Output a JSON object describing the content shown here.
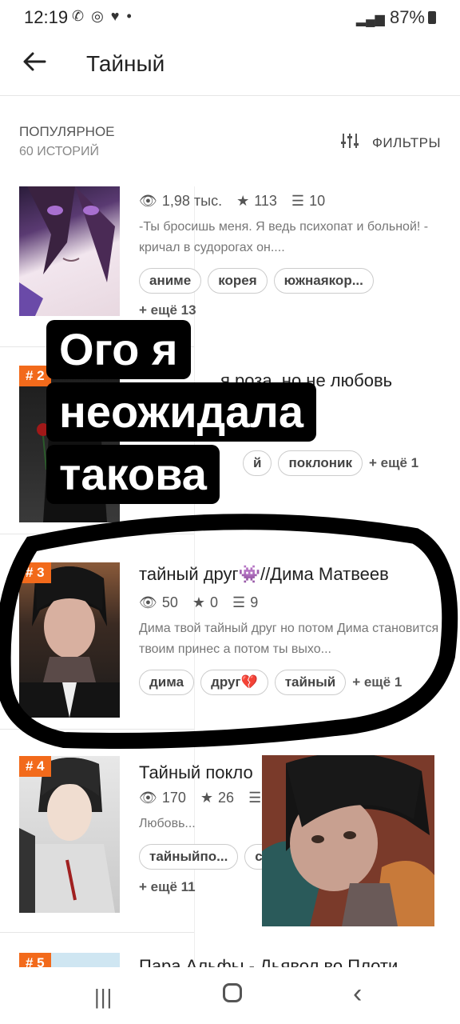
{
  "status_bar": {
    "time": "12:19",
    "icons": "✆ ◎ ♥ •",
    "network": "📶",
    "battery": "87%"
  },
  "app_bar": {
    "title": "Тайный"
  },
  "sort": {
    "title": "ПОПУЛЯРНОЕ",
    "count": "60 ИСТОРИЙ",
    "filters_label": "ФИЛЬТРЫ"
  },
  "stories": [
    {
      "rank": "",
      "title": "",
      "views": "1,98 тыс.",
      "likes": "113",
      "chapters": "10",
      "description": "-Ты бросишь меня. Я ведь психопат и больной! - кричал в судорогах он....",
      "tags": [
        "аниме",
        "корея",
        "южнаякор..."
      ],
      "more": "+ ещё 13"
    },
    {
      "rank": "# 2",
      "title": "я роза, но не любовь",
      "tags": [
        "й",
        "поклоник"
      ],
      "more": "+ ещё 1"
    },
    {
      "rank": "# 3",
      "title": "тайный друг👾//Дима Матвеев",
      "views": "50",
      "likes": "0",
      "chapters": "9",
      "description": "Дима твой тайный друг но потом Дима становится твоим принес а потом ты выхо...",
      "tags": [
        "дима",
        "друг💔",
        "тайный"
      ],
      "more": "+ ещё 1"
    },
    {
      "rank": "# 4",
      "title": "Тайный покло",
      "views": "170",
      "likes": "26",
      "description": "Любовь...",
      "tags": [
        "тайныйпо...",
        "с"
      ],
      "more": "+ ещё 11"
    },
    {
      "rank": "# 5",
      "title": "Пара Альфы - Дьявол во Плоти"
    }
  ],
  "overlay_caption": {
    "line1": "Ого я",
    "line2": "неожидала",
    "line3": "такова"
  },
  "nav": {
    "recent": "|||",
    "home": "",
    "back": "‹"
  }
}
